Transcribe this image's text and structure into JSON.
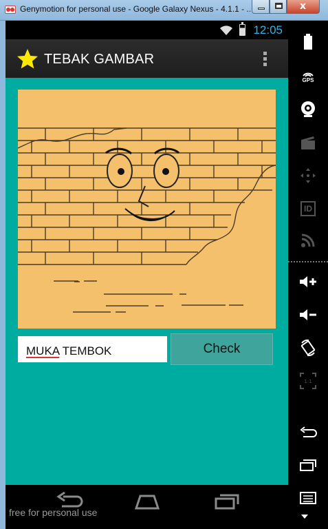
{
  "window": {
    "title": "Genymotion for personal use - Google Galaxy Nexus - 4.1.1 - ...",
    "close_glyph": "x"
  },
  "statusbar": {
    "clock": "12:05"
  },
  "app": {
    "title": "TEBAK GAMBAR",
    "accent_color": "#00ab9f",
    "star_color": "#ffe800"
  },
  "quiz": {
    "answer_value": "MUKA TEMBOK",
    "answer_words": [
      "MUKA",
      "TEMBOK"
    ],
    "check_label": "Check"
  },
  "footer": {
    "watermark": "free for personal use"
  },
  "sidepanel": {
    "items": [
      {
        "icon": "battery-icon"
      },
      {
        "icon": "gps-icon",
        "label": "GPS"
      },
      {
        "icon": "webcam-icon"
      },
      {
        "icon": "camera-clapper-icon"
      },
      {
        "icon": "dpad-icon"
      },
      {
        "icon": "id-icon",
        "label": "ID"
      },
      {
        "icon": "rss-icon"
      },
      {
        "icon": "volume-up-icon"
      },
      {
        "icon": "volume-down-icon"
      },
      {
        "icon": "rotate-icon"
      },
      {
        "icon": "scale-icon",
        "label": "1:1"
      },
      {
        "icon": "back-icon"
      },
      {
        "icon": "recent-apps-icon"
      },
      {
        "icon": "menu-icon"
      }
    ]
  }
}
